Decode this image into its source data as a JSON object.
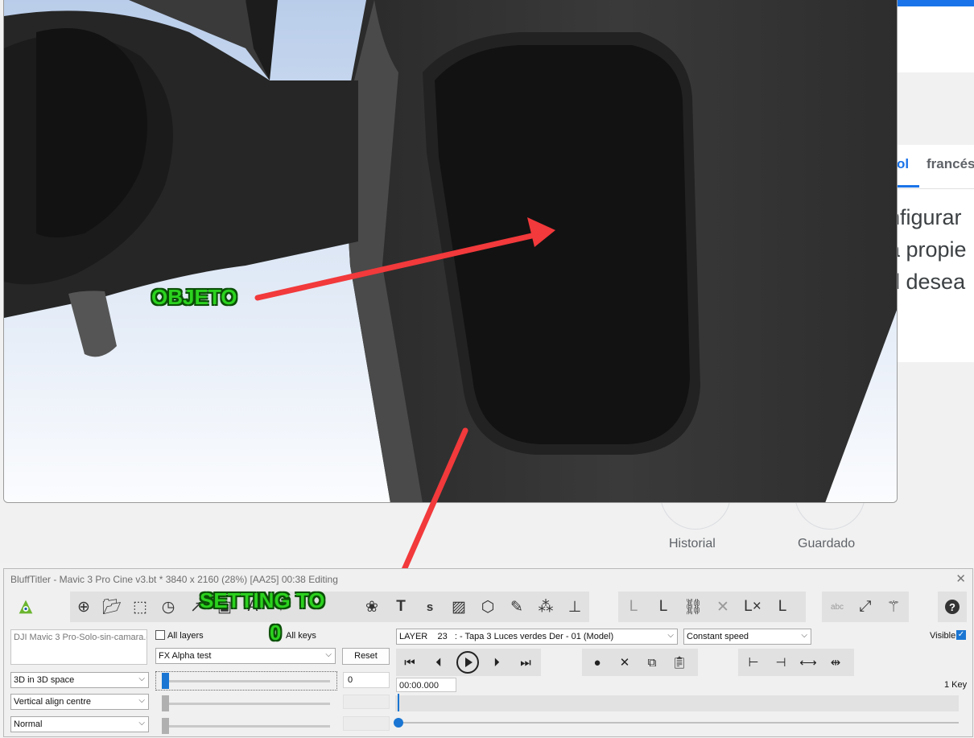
{
  "background_page": {
    "tabs": [
      "ol",
      "francés"
    ],
    "text_lines": [
      "nfigurar",
      "a propie",
      "d desea"
    ],
    "shortcuts": [
      "Historial",
      "Guardado"
    ]
  },
  "annotations": {
    "objeto": "OBJETO",
    "setting": "SETTING TO",
    "setting_value": "0"
  },
  "app": {
    "title": "BluffTitler - Mavic 3 Pro Cine v3.bt * 3840 x 2160 (28%) [AA25] 00:38 Editing",
    "toolbar": {
      "main_icons": [
        "add-icon",
        "open-folder-icon",
        "select-area-icon",
        "clock-icon",
        "chart-icon",
        "photo-icon",
        "effects-icon",
        "text-icon",
        "s-icon",
        "image-icon",
        "cube-icon",
        "brush-icon",
        "particles-icon",
        "layer-icon"
      ],
      "layer_icons": [
        "layer-dim-icon",
        "layer-link-icon",
        "layer-chain-icon",
        "collapse-dim-icon",
        "layer-delete-icon",
        "layer-new-icon"
      ],
      "view_icons": [
        "abc-icon",
        "resize-icon",
        "magic-wand-icon"
      ],
      "help_icon": "help-icon"
    },
    "file_name": "DJI Mavic 3 Pro-Solo-sin-camara.g",
    "all_layers_label": "All layers",
    "all_keys_label": "All keys",
    "effect_select": "FX Alpha test",
    "reset_label": "Reset",
    "space_select": "3D in 3D space",
    "align_select": "Vertical align centre",
    "blend_select": "Normal",
    "param_value": "0",
    "param_slider_value": 0,
    "layer_select": "LAYER    23   : - Tapa 3 Luces verdes Der - 01 (Model)",
    "speed_select": "Constant speed",
    "visible_label": "Visible",
    "visible_checked": true,
    "time_value": "00:00.000",
    "key_count": "1 Key",
    "transport_icons": [
      "skip-start-icon",
      "step-back-icon",
      "play-icon",
      "step-forward-icon",
      "skip-end-icon"
    ],
    "key_icons": [
      "record-icon",
      "delete-key-icon",
      "copy-icon",
      "paste-icon"
    ],
    "align_key_icons": [
      "align-left-icon",
      "align-right-icon",
      "stretch-icon",
      "compress-icon"
    ]
  }
}
